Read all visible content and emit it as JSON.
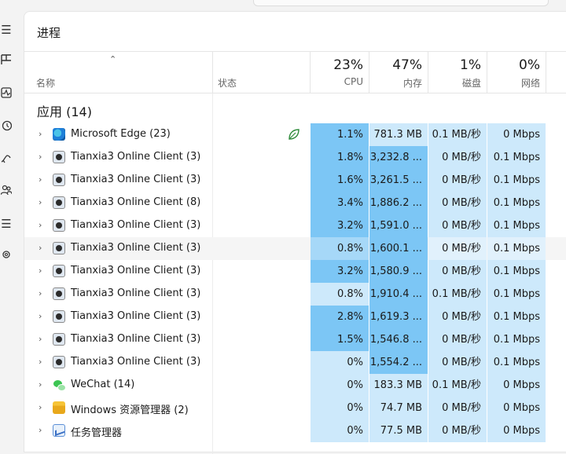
{
  "page_title": "进程",
  "rail_icons": [
    "menu-icon",
    "processes-icon",
    "performance-icon",
    "history-icon",
    "startup-icon",
    "users-icon",
    "details-icon",
    "services-icon"
  ],
  "columns": {
    "name": "名称",
    "status": "状态",
    "cpu": {
      "pct": "23%",
      "label": "CPU"
    },
    "mem": {
      "pct": "47%",
      "label": "内存"
    },
    "disk": {
      "pct": "1%",
      "label": "磁盘"
    },
    "net": {
      "pct": "0%",
      "label": "网络"
    }
  },
  "group_title": "应用 (14)",
  "colors": {
    "heat_strong": "#7cc6f5",
    "heat_mid": "#a6d8f8",
    "heat_light": "#cde9fb",
    "heat_faint": "#e1f1fc"
  },
  "rows": [
    {
      "name": "Microsoft Edge (23)",
      "icon": "edge-icon",
      "efficiency": true,
      "cpu": "1.1%",
      "mem": "781.3 MB",
      "disk": "0.1 MB/秒",
      "net": "0 Mbps",
      "heat": [
        "heat_strong",
        "heat_light",
        "heat_light",
        "heat_light"
      ]
    },
    {
      "name": "Tianxia3 Online Client (3)",
      "icon": "tianxia-icon",
      "cpu": "1.8%",
      "mem": "3,232.8 ...",
      "disk": "0 MB/秒",
      "net": "0.1 Mbps",
      "heat": [
        "heat_strong",
        "heat_strong",
        "heat_light",
        "heat_light"
      ]
    },
    {
      "name": "Tianxia3 Online Client (3)",
      "icon": "tianxia-icon",
      "cpu": "1.6%",
      "mem": "3,261.5 ...",
      "disk": "0 MB/秒",
      "net": "0.1 Mbps",
      "heat": [
        "heat_strong",
        "heat_strong",
        "heat_light",
        "heat_light"
      ]
    },
    {
      "name": "Tianxia3 Online Client (8)",
      "icon": "tianxia-icon",
      "cpu": "3.4%",
      "mem": "1,886.2 ...",
      "disk": "0 MB/秒",
      "net": "0.1 Mbps",
      "heat": [
        "heat_strong",
        "heat_strong",
        "heat_light",
        "heat_light"
      ]
    },
    {
      "name": "Tianxia3 Online Client (3)",
      "icon": "tianxia-icon",
      "cpu": "3.2%",
      "mem": "1,591.0 ...",
      "disk": "0 MB/秒",
      "net": "0.1 Mbps",
      "heat": [
        "heat_strong",
        "heat_strong",
        "heat_light",
        "heat_light"
      ]
    },
    {
      "name": "Tianxia3 Online Client (3)",
      "icon": "tianxia-icon",
      "highlight": true,
      "cpu": "0.8%",
      "mem": "1,600.1 ...",
      "disk": "0 MB/秒",
      "net": "0.1 Mbps",
      "heat": [
        "heat_mid",
        "heat_strong",
        "heat_faint",
        "heat_faint"
      ]
    },
    {
      "name": "Tianxia3 Online Client (3)",
      "icon": "tianxia-icon",
      "cpu": "3.2%",
      "mem": "1,580.9 ...",
      "disk": "0 MB/秒",
      "net": "0.1 Mbps",
      "heat": [
        "heat_strong",
        "heat_strong",
        "heat_light",
        "heat_light"
      ]
    },
    {
      "name": "Tianxia3 Online Client (3)",
      "icon": "tianxia-icon",
      "cpu": "0.8%",
      "mem": "1,910.4 ...",
      "disk": "0.1 MB/秒",
      "net": "0.1 Mbps",
      "heat": [
        "heat_light",
        "heat_strong",
        "heat_light",
        "heat_light"
      ]
    },
    {
      "name": "Tianxia3 Online Client (3)",
      "icon": "tianxia-icon",
      "cpu": "2.8%",
      "mem": "1,619.3 ...",
      "disk": "0 MB/秒",
      "net": "0.1 Mbps",
      "heat": [
        "heat_strong",
        "heat_strong",
        "heat_light",
        "heat_light"
      ]
    },
    {
      "name": "Tianxia3 Online Client (3)",
      "icon": "tianxia-icon",
      "cpu": "1.5%",
      "mem": "1,546.8 ...",
      "disk": "0 MB/秒",
      "net": "0.1 Mbps",
      "heat": [
        "heat_strong",
        "heat_strong",
        "heat_light",
        "heat_light"
      ]
    },
    {
      "name": "Tianxia3 Online Client (3)",
      "icon": "tianxia-icon",
      "cpu": "0%",
      "mem": "1,554.2 ...",
      "disk": "0 MB/秒",
      "net": "0.1 Mbps",
      "heat": [
        "heat_light",
        "heat_strong",
        "heat_light",
        "heat_light"
      ]
    },
    {
      "name": "WeChat (14)",
      "icon": "wechat-icon",
      "cpu": "0%",
      "mem": "183.3 MB",
      "disk": "0.1 MB/秒",
      "net": "0 Mbps",
      "heat": [
        "heat_light",
        "heat_light",
        "heat_light",
        "heat_light"
      ]
    },
    {
      "name": "Windows 资源管理器 (2)",
      "icon": "file-explorer-icon",
      "cpu": "0%",
      "mem": "74.7 MB",
      "disk": "0 MB/秒",
      "net": "0 Mbps",
      "heat": [
        "heat_light",
        "heat_light",
        "heat_light",
        "heat_light"
      ]
    },
    {
      "name": "任务管理器",
      "icon": "task-manager-icon",
      "cpu": "0%",
      "mem": "77.5 MB",
      "disk": "0 MB/秒",
      "net": "0 Mbps",
      "heat": [
        "heat_light",
        "heat_light",
        "heat_light",
        "heat_light"
      ]
    }
  ]
}
